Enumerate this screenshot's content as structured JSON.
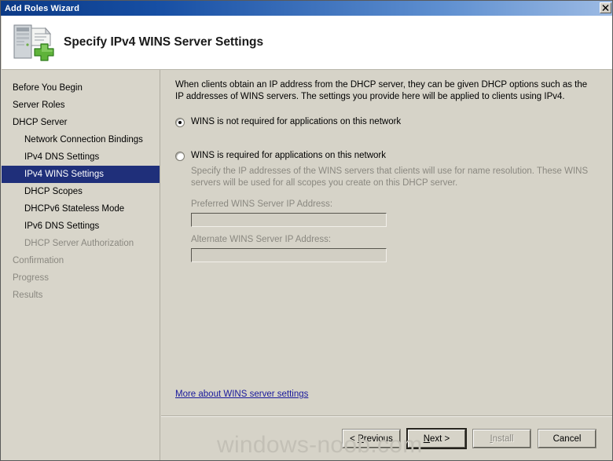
{
  "window": {
    "title": "Add Roles Wizard",
    "close_label": "x"
  },
  "header": {
    "title": "Specify IPv4 WINS Server Settings",
    "icon": "server-add-icon"
  },
  "sidebar": {
    "items": [
      {
        "label": "Before You Begin",
        "indent": false,
        "state": "normal"
      },
      {
        "label": "Server Roles",
        "indent": false,
        "state": "normal"
      },
      {
        "label": "DHCP Server",
        "indent": false,
        "state": "normal"
      },
      {
        "label": "Network Connection Bindings",
        "indent": true,
        "state": "normal"
      },
      {
        "label": "IPv4 DNS Settings",
        "indent": true,
        "state": "normal"
      },
      {
        "label": "IPv4 WINS Settings",
        "indent": true,
        "state": "selected"
      },
      {
        "label": "DHCP Scopes",
        "indent": true,
        "state": "normal"
      },
      {
        "label": "DHCPv6 Stateless Mode",
        "indent": true,
        "state": "normal"
      },
      {
        "label": "IPv6 DNS Settings",
        "indent": true,
        "state": "normal"
      },
      {
        "label": "DHCP Server Authorization",
        "indent": true,
        "state": "disabled"
      },
      {
        "label": "Confirmation",
        "indent": false,
        "state": "disabled"
      },
      {
        "label": "Progress",
        "indent": false,
        "state": "disabled"
      },
      {
        "label": "Results",
        "indent": false,
        "state": "disabled"
      }
    ]
  },
  "content": {
    "intro": "When clients obtain an IP address from the DHCP server, they can be given DHCP options such as the IP addresses of WINS servers. The settings you provide here will be applied to clients using IPv4.",
    "radio_not_required": "WINS is not required for applications on this network",
    "radio_required": "WINS is required for applications on this network",
    "radio_required_description": "Specify the IP addresses of the WINS servers that clients will use for name resolution. These WINS servers will be used for all scopes you create on this DHCP server.",
    "preferred_label": "Preferred WINS Server IP Address:",
    "preferred_value": "",
    "alternate_label": "Alternate WINS Server IP Address:",
    "alternate_value": "",
    "more_link": "More about WINS server settings"
  },
  "footer": {
    "previous": "< Previous",
    "previous_accel": "P",
    "next": "Next >",
    "next_accel": "N",
    "install": "Install",
    "install_accel": "I",
    "cancel": "Cancel"
  },
  "watermark": "windows-noob.com",
  "colors": {
    "titlebar_start": "#0c3a86",
    "titlebar_end": "#9dbbe4",
    "dialog_face": "#d6d3c8",
    "sidebar_face": "#d8d5ca",
    "selected_nav": "#1f2f7a",
    "link": "#19199c",
    "disabled_text": "#8a8880",
    "watermark": "#c3c0b6"
  }
}
